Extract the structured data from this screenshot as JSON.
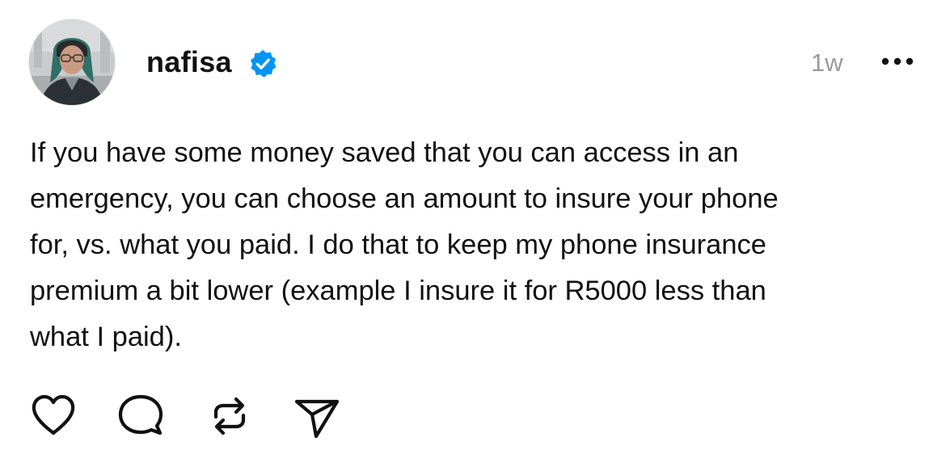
{
  "post": {
    "author": {
      "username": "nafisa",
      "verified_icon": "verified-badge-icon",
      "avatar_icon": "profile-photo"
    },
    "timestamp": "1w",
    "more_icon": "more-options-icon",
    "text_lines": [
      "If you have some money saved that you can access in an",
      "emergency, you can choose an amount to insure your phone",
      "for, vs. what you paid. I do that to keep my phone insurance",
      "premium a bit lower (example I insure it for R5000 less than",
      "what I paid)."
    ],
    "actions": [
      {
        "name": "like",
        "icon": "heart-icon"
      },
      {
        "name": "comment",
        "icon": "comment-bubble-icon"
      },
      {
        "name": "repost",
        "icon": "repost-icon"
      },
      {
        "name": "share",
        "icon": "send-icon"
      }
    ],
    "colors": {
      "text": "#111111",
      "muted": "#9a9a9a",
      "verified": "#0095f6",
      "background": "#ffffff"
    }
  }
}
